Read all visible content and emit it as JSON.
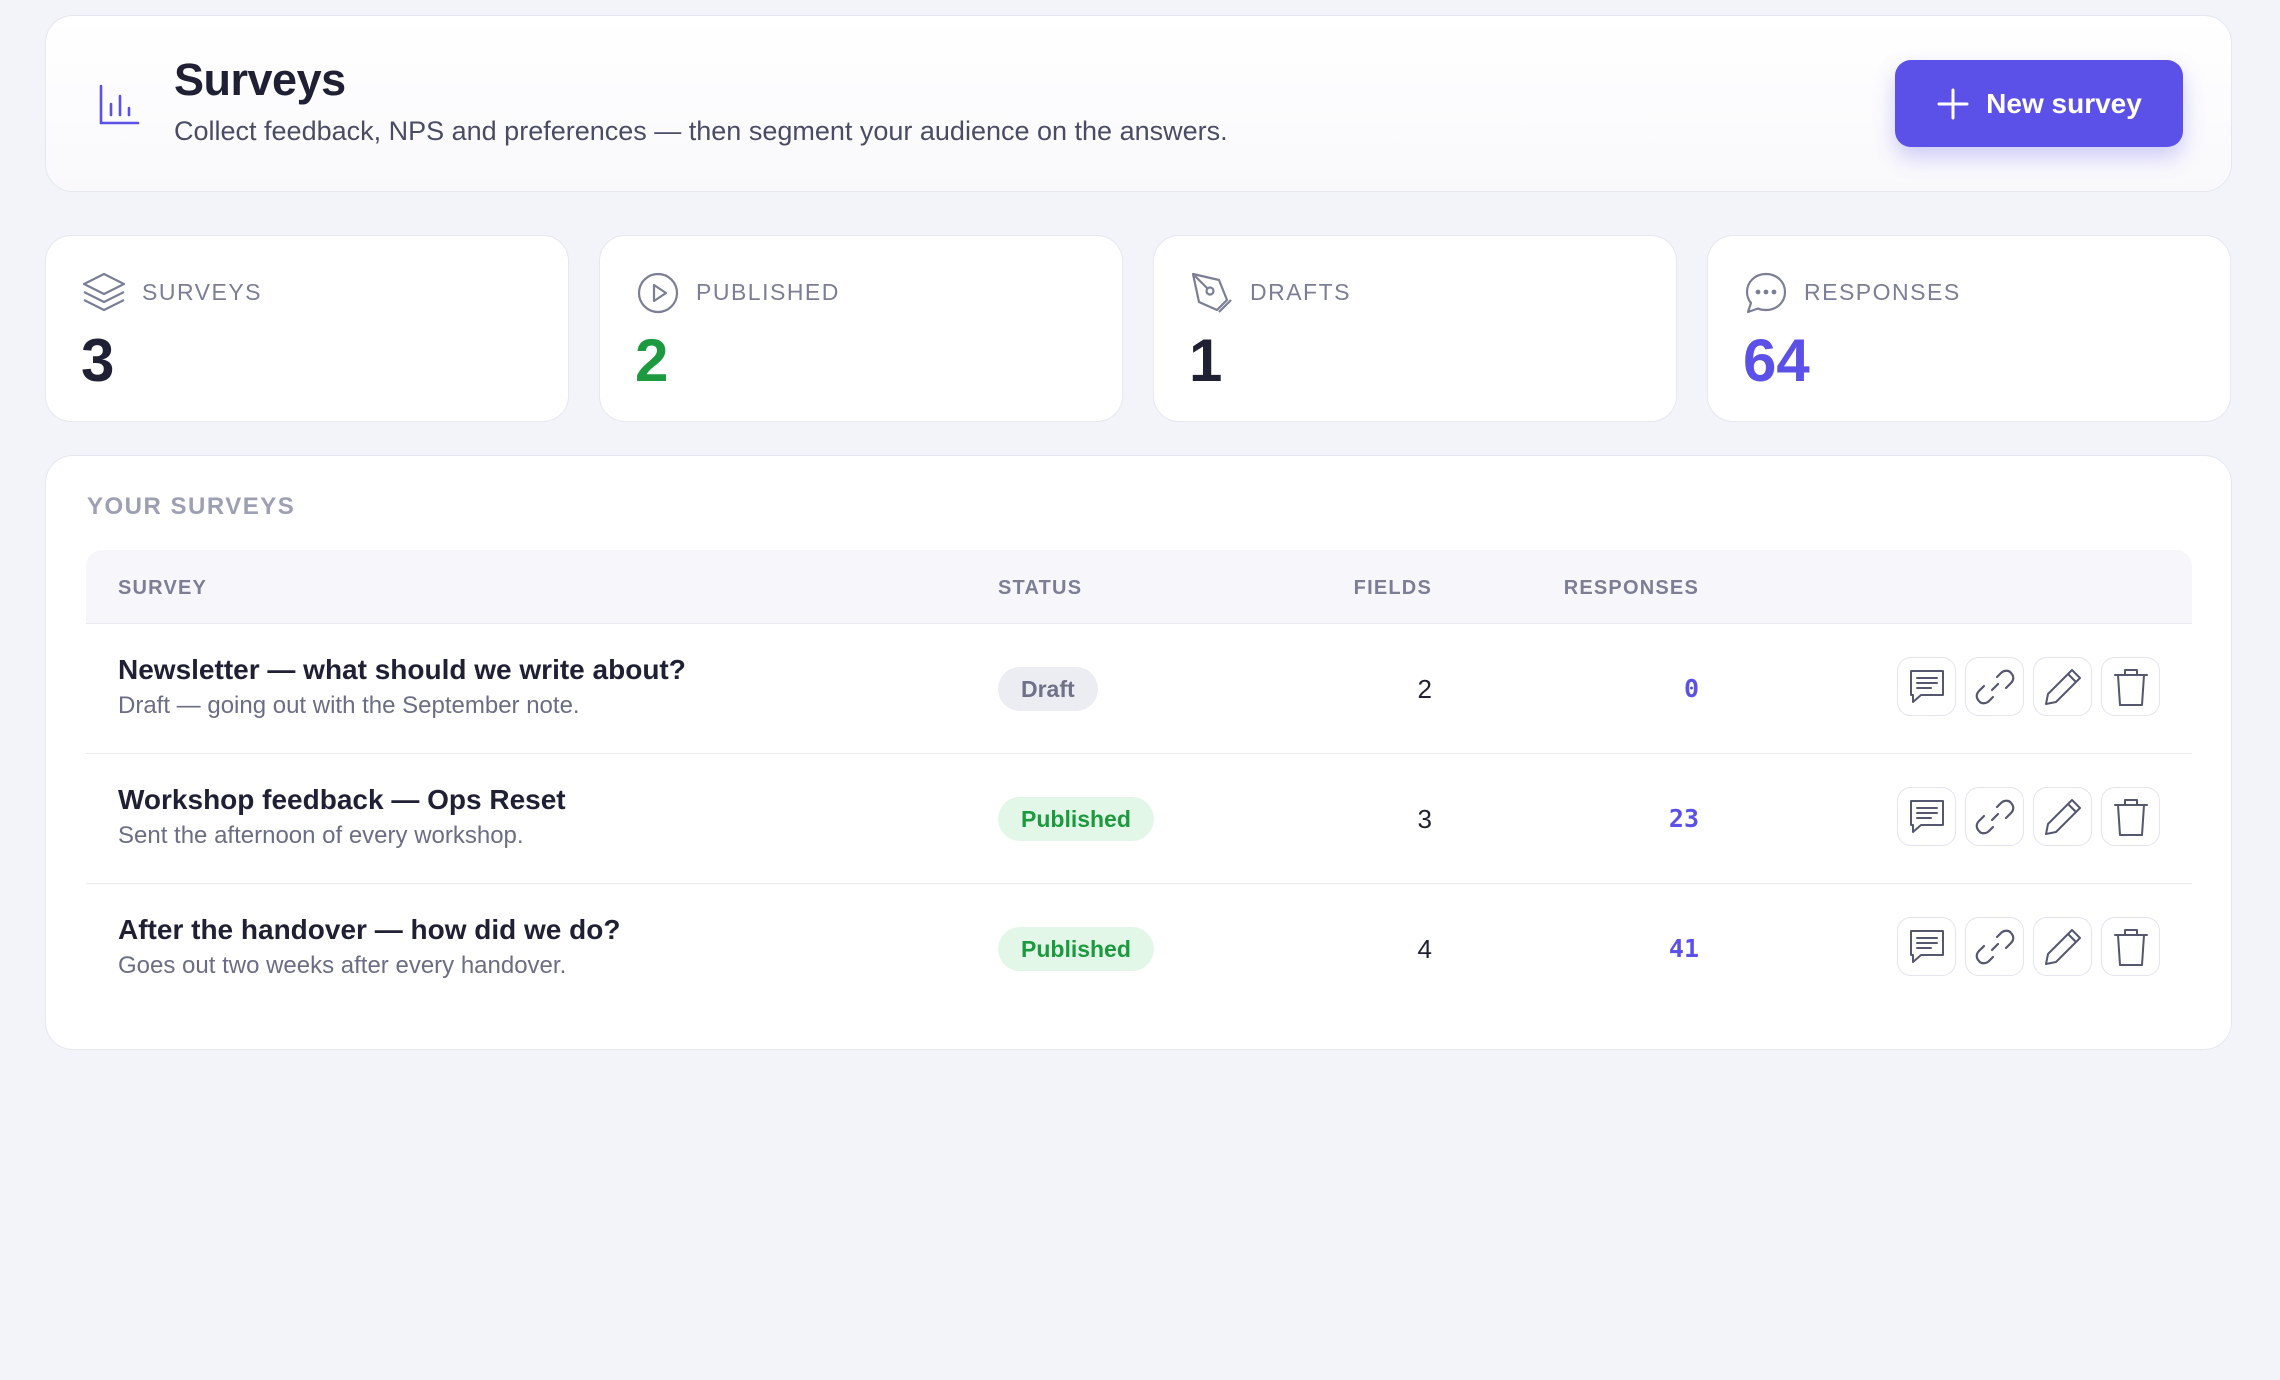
{
  "header": {
    "title": "Surveys",
    "subtitle": "Collect feedback, NPS and preferences — then segment your audience on the answers.",
    "icon": "bar-chart-icon",
    "new_button_label": "New survey"
  },
  "stats": [
    {
      "label": "SURVEYS",
      "value": "3",
      "icon": "layers-icon",
      "color": "#1f2033"
    },
    {
      "label": "PUBLISHED",
      "value": "2",
      "icon": "play-circle-icon",
      "color": "#1d9a3f"
    },
    {
      "label": "DRAFTS",
      "value": "1",
      "icon": "pen-tool-icon",
      "color": "#1f2033"
    },
    {
      "label": "RESPONSES",
      "value": "64",
      "icon": "message-circle-icon",
      "color": "#5b50e8"
    }
  ],
  "table": {
    "title": "YOUR SURVEYS",
    "columns": [
      "SURVEY",
      "STATUS",
      "FIELDS",
      "RESPONSES"
    ],
    "rows": [
      {
        "name": "Newsletter — what should we write about?",
        "description": "Draft — going out with the September note.",
        "status": "Draft",
        "fields": "2",
        "responses": "0"
      },
      {
        "name": "Workshop feedback — Ops Reset",
        "description": "Sent the afternoon of every workshop.",
        "status": "Published",
        "fields": "3",
        "responses": "23"
      },
      {
        "name": "After the handover — how did we do?",
        "description": "Goes out two weeks after every handover.",
        "status": "Published",
        "fields": "4",
        "responses": "41"
      }
    ]
  },
  "colors": {
    "accent": "#5b50e8",
    "success": "#1d9a3f",
    "background": "#f3f4f9"
  }
}
